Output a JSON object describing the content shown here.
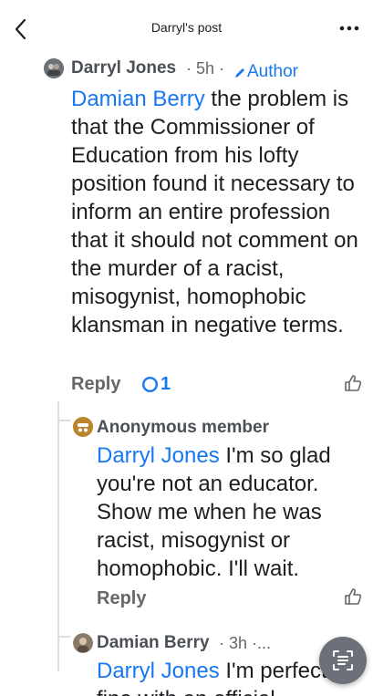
{
  "header": {
    "title": "Darryl's post"
  },
  "comments": [
    {
      "author": "Darryl Jones",
      "time": "· 5h ·",
      "author_badge": "Author",
      "mention": "Damian Berry",
      "text": " the problem is that the Commissioner of Education from his lofty position found it necessary to inform an entire profession that it should not comment on the murder of a racist, misogynist, homophobic klansman in negative terms.",
      "reply_label": "Reply",
      "reaction_count": "1"
    },
    {
      "author": "Anonymous member",
      "mention": "Darryl Jones",
      "text": " I'm so glad you're not an educator. Show me when he was racist, misogynist or homophobic. I'll wait.",
      "reply_label": "Reply"
    },
    {
      "author": "Damian Berry",
      "time": "· 3h ·...",
      "mention": "Darryl Jones",
      "text": " I'm perfectly fine with an official"
    }
  ],
  "colors": {
    "accent": "#1877f2",
    "muted": "#65676b"
  }
}
